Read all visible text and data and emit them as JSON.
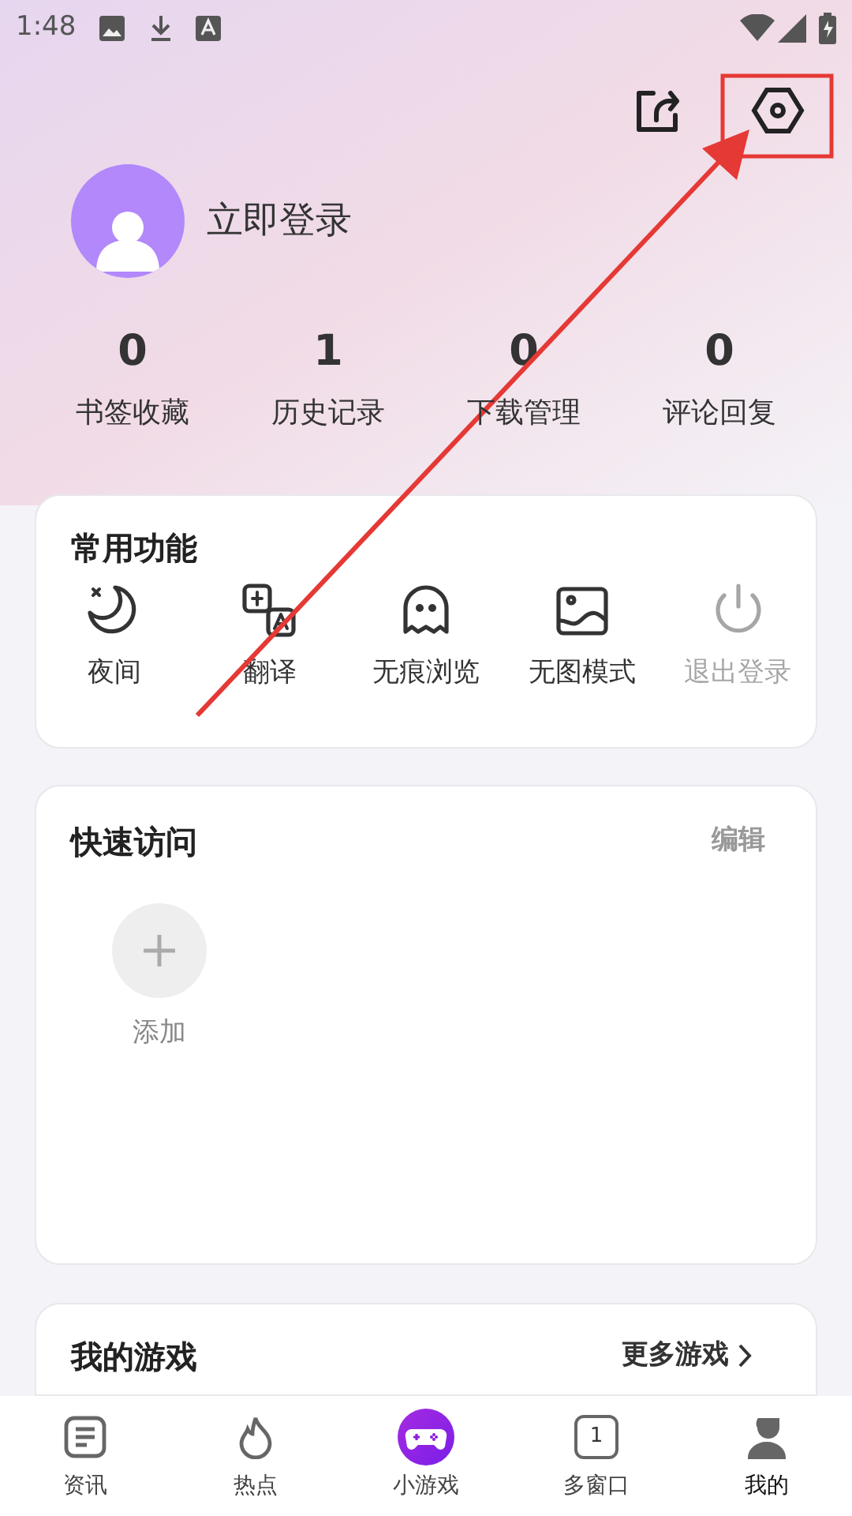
{
  "status_bar": {
    "time": "1:48"
  },
  "profile": {
    "login": "立即登录"
  },
  "stats": [
    {
      "value": "0",
      "label": "书签收藏"
    },
    {
      "value": "1",
      "label": "历史记录"
    },
    {
      "value": "0",
      "label": "下载管理"
    },
    {
      "value": "0",
      "label": "评论回复"
    }
  ],
  "common_functions": {
    "title": "常用功能",
    "items": [
      {
        "kind": "night",
        "label": "夜间",
        "disabled": false
      },
      {
        "kind": "translate",
        "label": "翻译",
        "disabled": false
      },
      {
        "kind": "incognito",
        "label": "无痕浏览",
        "disabled": false
      },
      {
        "kind": "noimage",
        "label": "无图模式",
        "disabled": false
      },
      {
        "kind": "logout",
        "label": "退出登录",
        "disabled": true
      }
    ]
  },
  "quick_access": {
    "title": "快速访问",
    "edit": "编辑",
    "add_label": "添加"
  },
  "my_games": {
    "title": "我的游戏",
    "more": "更多游戏"
  },
  "bottom_nav": [
    {
      "kind": "news",
      "label": "资讯",
      "selected": false
    },
    {
      "kind": "hot",
      "label": "热点",
      "selected": false
    },
    {
      "kind": "game",
      "label": "小游戏",
      "selected": false
    },
    {
      "kind": "windows",
      "label": "多窗口",
      "count": "1",
      "selected": false
    },
    {
      "kind": "me",
      "label": "我的",
      "selected": true
    }
  ]
}
